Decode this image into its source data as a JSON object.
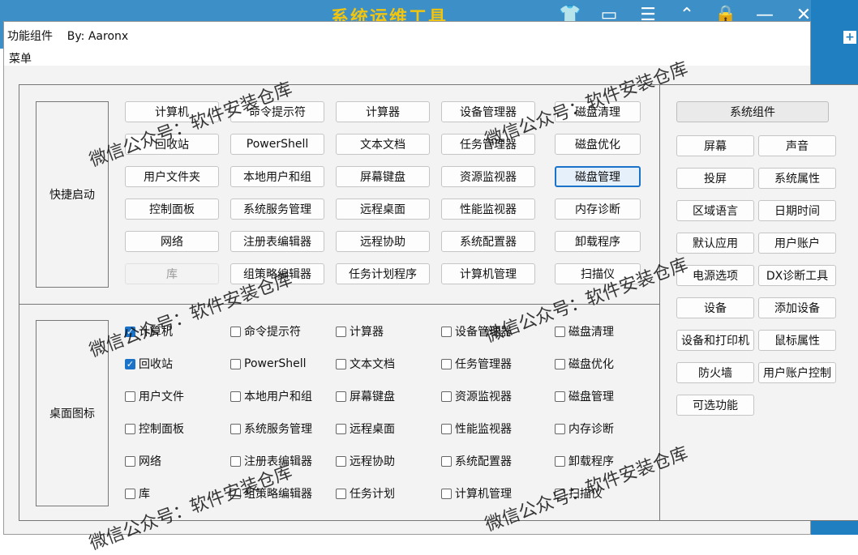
{
  "background": {
    "title": "系统运维工具",
    "icons": [
      "shirt-icon",
      "window-icon",
      "menu-icon",
      "chevron-up-icon",
      "lock-icon",
      "minimize-icon",
      "close-icon"
    ],
    "plus": "+"
  },
  "window": {
    "title": "功能组件    By: Aaronx",
    "menu": "菜单"
  },
  "quick": {
    "label": "快捷启动",
    "buttons": [
      "计算机",
      "命令提示符",
      "计算器",
      "设备管理器",
      "磁盘清理",
      "回收站",
      "PowerShell",
      "文本文档",
      "任务管理器",
      "磁盘优化",
      "用户文件夹",
      "本地用户和组",
      "屏幕键盘",
      "资源监视器",
      "磁盘管理",
      "控制面板",
      "系统服务管理",
      "远程桌面",
      "性能监视器",
      "内存诊断",
      "网络",
      "注册表编辑器",
      "远程协助",
      "系统配置器",
      "卸载程序",
      "库",
      "组策略编辑器",
      "任务计划程序",
      "计算机管理",
      "扫描仪"
    ]
  },
  "desktop": {
    "label": "桌面图标",
    "items": [
      "计算机",
      "命令提示符",
      "计算器",
      "设备管理器",
      "磁盘清理",
      "回收站",
      "PowerShell",
      "文本文档",
      "任务管理器",
      "磁盘优化",
      "用户文件",
      "本地用户和组",
      "屏幕键盘",
      "资源监视器",
      "磁盘管理",
      "控制面板",
      "系统服务管理",
      "远程桌面",
      "性能监视器",
      "内存诊断",
      "网络",
      "注册表编辑器",
      "远程协助",
      "系统配置器",
      "卸载程序",
      "库",
      "组策略编辑器",
      "任务计划",
      "计算机管理",
      "扫描仪"
    ],
    "checked": [
      0,
      5
    ]
  },
  "system": {
    "header": "系统组件",
    "buttons": [
      "屏幕",
      "声音",
      "投屏",
      "系统属性",
      "区域语言",
      "日期时间",
      "默认应用",
      "用户账户",
      "电源选项",
      "DX诊断工具",
      "设备",
      "添加设备",
      "设备和打印机",
      "鼠标属性",
      "防火墙",
      "用户账户控制",
      "可选功能"
    ]
  },
  "watermark": "微信公众号：软件安装仓库"
}
